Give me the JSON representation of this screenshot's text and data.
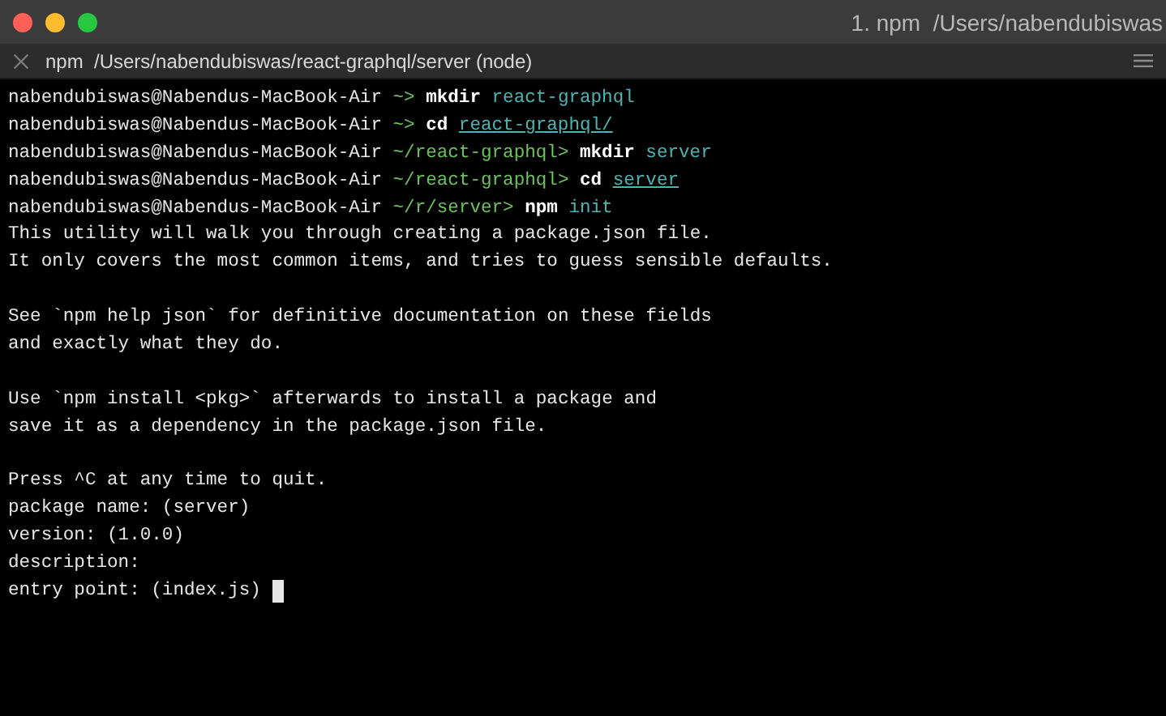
{
  "window": {
    "title": "1. npm  /Users/nabendubiswas"
  },
  "tab": {
    "title": "npm  /Users/nabendubiswas/react-graphql/server (node)"
  },
  "terminal": {
    "cursor_visible": true,
    "lines": [
      {
        "kind": "prompt",
        "user": "nabendubiswas@Nabendus-MacBook-Air",
        "path": "~>",
        "command": "mkdir",
        "argument": "react-graphql",
        "argument_underlined": false
      },
      {
        "kind": "prompt",
        "user": "nabendubiswas@Nabendus-MacBook-Air",
        "path": "~>",
        "command": "cd",
        "argument": "react-graphql/",
        "argument_underlined": true
      },
      {
        "kind": "prompt",
        "user": "nabendubiswas@Nabendus-MacBook-Air",
        "path": "~/react-graphql>",
        "command": "mkdir",
        "argument": "server",
        "argument_underlined": false
      },
      {
        "kind": "prompt",
        "user": "nabendubiswas@Nabendus-MacBook-Air",
        "path": "~/react-graphql>",
        "command": "cd",
        "argument": "server",
        "argument_underlined": true
      },
      {
        "kind": "prompt",
        "user": "nabendubiswas@Nabendus-MacBook-Air",
        "path": "~/r/server>",
        "command": "npm",
        "argument": "init",
        "argument_underlined": false
      },
      {
        "kind": "output",
        "text": "This utility will walk you through creating a package.json file."
      },
      {
        "kind": "output",
        "text": "It only covers the most common items, and tries to guess sensible defaults."
      },
      {
        "kind": "blank"
      },
      {
        "kind": "output",
        "text": "See `npm help json` for definitive documentation on these fields"
      },
      {
        "kind": "output",
        "text": "and exactly what they do."
      },
      {
        "kind": "blank"
      },
      {
        "kind": "output",
        "text": "Use `npm install <pkg>` afterwards to install a package and"
      },
      {
        "kind": "output",
        "text": "save it as a dependency in the package.json file."
      },
      {
        "kind": "blank"
      },
      {
        "kind": "output",
        "text": "Press ^C at any time to quit."
      },
      {
        "kind": "output",
        "text": "package name: (server)"
      },
      {
        "kind": "output",
        "text": "version: (1.0.0)"
      },
      {
        "kind": "output",
        "text": "description:"
      },
      {
        "kind": "output",
        "text": "entry point: (index.js)"
      }
    ]
  }
}
